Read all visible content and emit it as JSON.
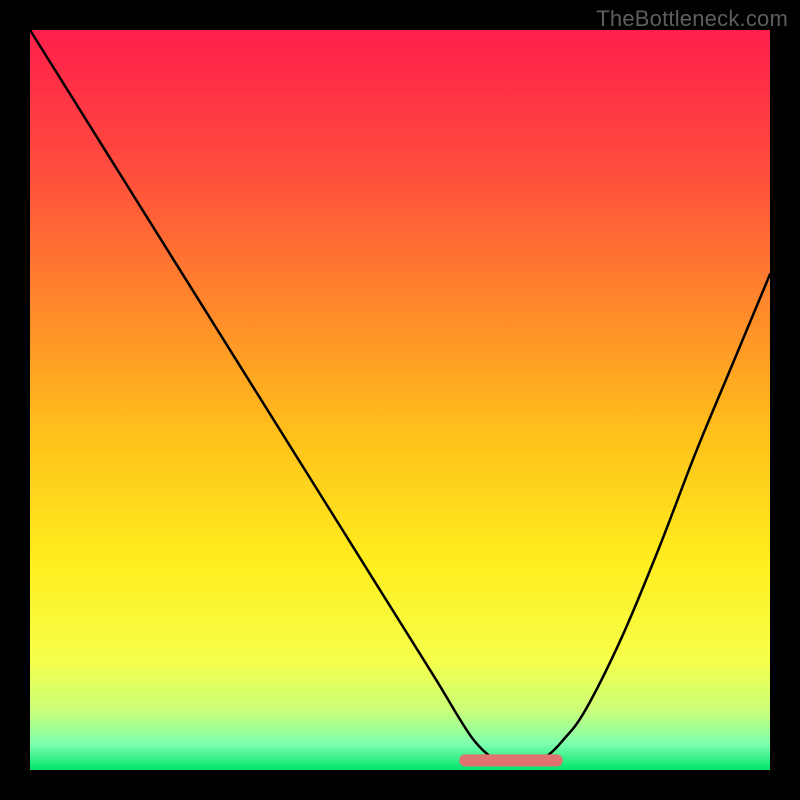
{
  "watermark": "TheBottleneck.com",
  "chart_data": {
    "type": "line",
    "title": "",
    "xlabel": "",
    "ylabel": "",
    "xlim": [
      0,
      100
    ],
    "ylim": [
      0,
      100
    ],
    "x": [
      0,
      5,
      10,
      15,
      20,
      25,
      30,
      35,
      40,
      45,
      50,
      55,
      58,
      60,
      62,
      64,
      66,
      68,
      70,
      72,
      75,
      80,
      85,
      90,
      95,
      100
    ],
    "values": [
      100,
      92,
      84,
      76,
      68,
      60,
      52,
      44,
      36,
      28,
      20,
      12,
      7,
      4,
      2,
      1,
      1,
      1,
      2,
      4,
      8,
      18,
      30,
      43,
      55,
      67
    ],
    "optimal_band": {
      "x_start": 58,
      "x_end": 72,
      "y": 1.3
    },
    "gradient_stops": [
      {
        "offset": 0.0,
        "color": "#ff1f4b"
      },
      {
        "offset": 0.18,
        "color": "#ff4a3e"
      },
      {
        "offset": 0.38,
        "color": "#ff8a2a"
      },
      {
        "offset": 0.55,
        "color": "#ffc21a"
      },
      {
        "offset": 0.72,
        "color": "#ffee1e"
      },
      {
        "offset": 0.85,
        "color": "#f6ff4a"
      },
      {
        "offset": 0.92,
        "color": "#caff7a"
      },
      {
        "offset": 0.965,
        "color": "#7dffae"
      },
      {
        "offset": 1.0,
        "color": "#00e46a"
      }
    ]
  }
}
